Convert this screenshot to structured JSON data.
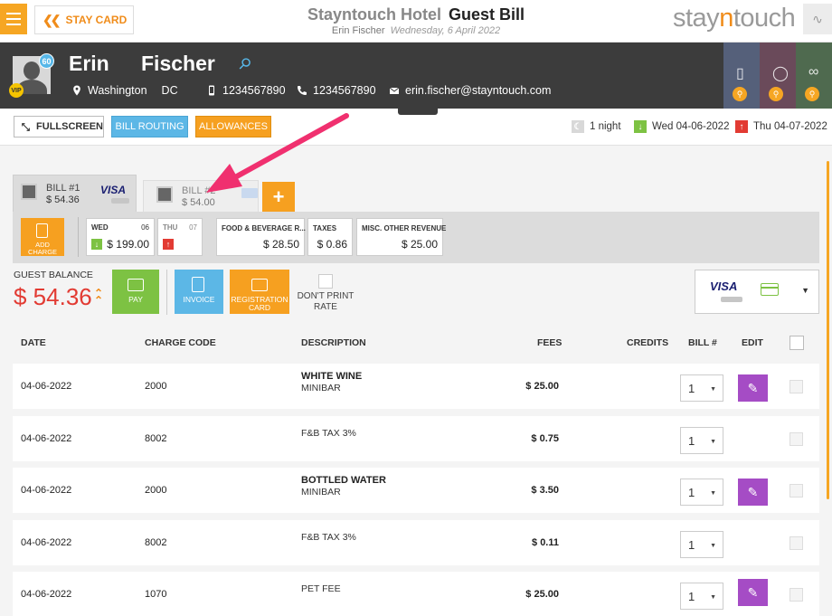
{
  "header": {
    "stay_card_label": "STAY CARD",
    "hotel_name": "Stayntouch Hotel",
    "page_title": "Guest Bill",
    "guest_name": "Erin Fischer",
    "date": "Wednesday, 6 April 2022",
    "logo_left": "stay",
    "logo_n": "n",
    "logo_right": "touch"
  },
  "guest": {
    "first_name": "Erin",
    "last_name": "Fischer",
    "badge_count": "60",
    "vip": "VIP",
    "city": "Washington",
    "state": "DC",
    "phone1": "1234567890",
    "phone2": "1234567890",
    "email": "erin.fischer@stayntouch.com"
  },
  "actions": {
    "fullscreen": "FULLSCREEN",
    "bill_routing": "BILL ROUTING",
    "allowances": "ALLOWANCES",
    "nights": "1 night",
    "arrival": "Wed 04-06-2022",
    "departure": "Thu 04-07-2022"
  },
  "bills": [
    {
      "name": "BILL #1",
      "amount": "$ 54.36",
      "card": "VISA"
    },
    {
      "name": "BILL #2",
      "amount": "$ 54.00"
    }
  ],
  "add_bill": "+",
  "band": {
    "add_charge": "ADD CHARGE",
    "days": [
      {
        "name": "WED",
        "num": "06",
        "amount": "$ 199.00"
      },
      {
        "name": "THU",
        "num": "07",
        "amount": ""
      }
    ],
    "summaries": [
      {
        "name": "FOOD & BEVERAGE R...",
        "amount": "$ 28.50"
      },
      {
        "name": "TAXES",
        "amount": "$ 0.86"
      },
      {
        "name": "MISC. OTHER REVENUE",
        "amount": "$ 25.00"
      }
    ]
  },
  "balance": {
    "label": "GUEST BALANCE",
    "amount": "$ 54.36",
    "pay": "PAY",
    "invoice": "INVOICE",
    "registration_card": "REGISTRATION CARD",
    "dont_print": "DON'T PRINT RATE",
    "card": "VISA"
  },
  "table": {
    "headers": {
      "date": "DATE",
      "charge_code": "CHARGE CODE",
      "description": "DESCRIPTION",
      "fees": "FEES",
      "credits": "CREDITS",
      "bill": "BILL #",
      "edit": "EDIT"
    },
    "rows": [
      {
        "date": "04-06-2022",
        "code": "2000",
        "desc": "WHITE WINE",
        "desc2": "MINIBAR",
        "fees": "$ 25.00",
        "bill": "1",
        "editable": true
      },
      {
        "date": "04-06-2022",
        "code": "8002",
        "desc": "F&B TAX 3%",
        "desc2": "",
        "fees": "$ 0.75",
        "bill": "1",
        "editable": false
      },
      {
        "date": "04-06-2022",
        "code": "2000",
        "desc": "BOTTLED WATER",
        "desc2": "MINIBAR",
        "fees": "$ 3.50",
        "bill": "1",
        "editable": true
      },
      {
        "date": "04-06-2022",
        "code": "8002",
        "desc": "F&B TAX 3%",
        "desc2": "",
        "fees": "$ 0.11",
        "bill": "1",
        "editable": false
      },
      {
        "date": "04-06-2022",
        "code": "1070",
        "desc": "PET FEE",
        "desc2": "",
        "fees": "$ 25.00",
        "bill": "1",
        "editable": true
      }
    ]
  },
  "colors": {
    "accent_orange": "#f6a020",
    "accent_blue": "#5cb7e6",
    "pay_green": "#7dc243",
    "edit_purple": "#a54cc5",
    "balance_red": "#e23b33",
    "annotation_pink": "#f0306f"
  }
}
